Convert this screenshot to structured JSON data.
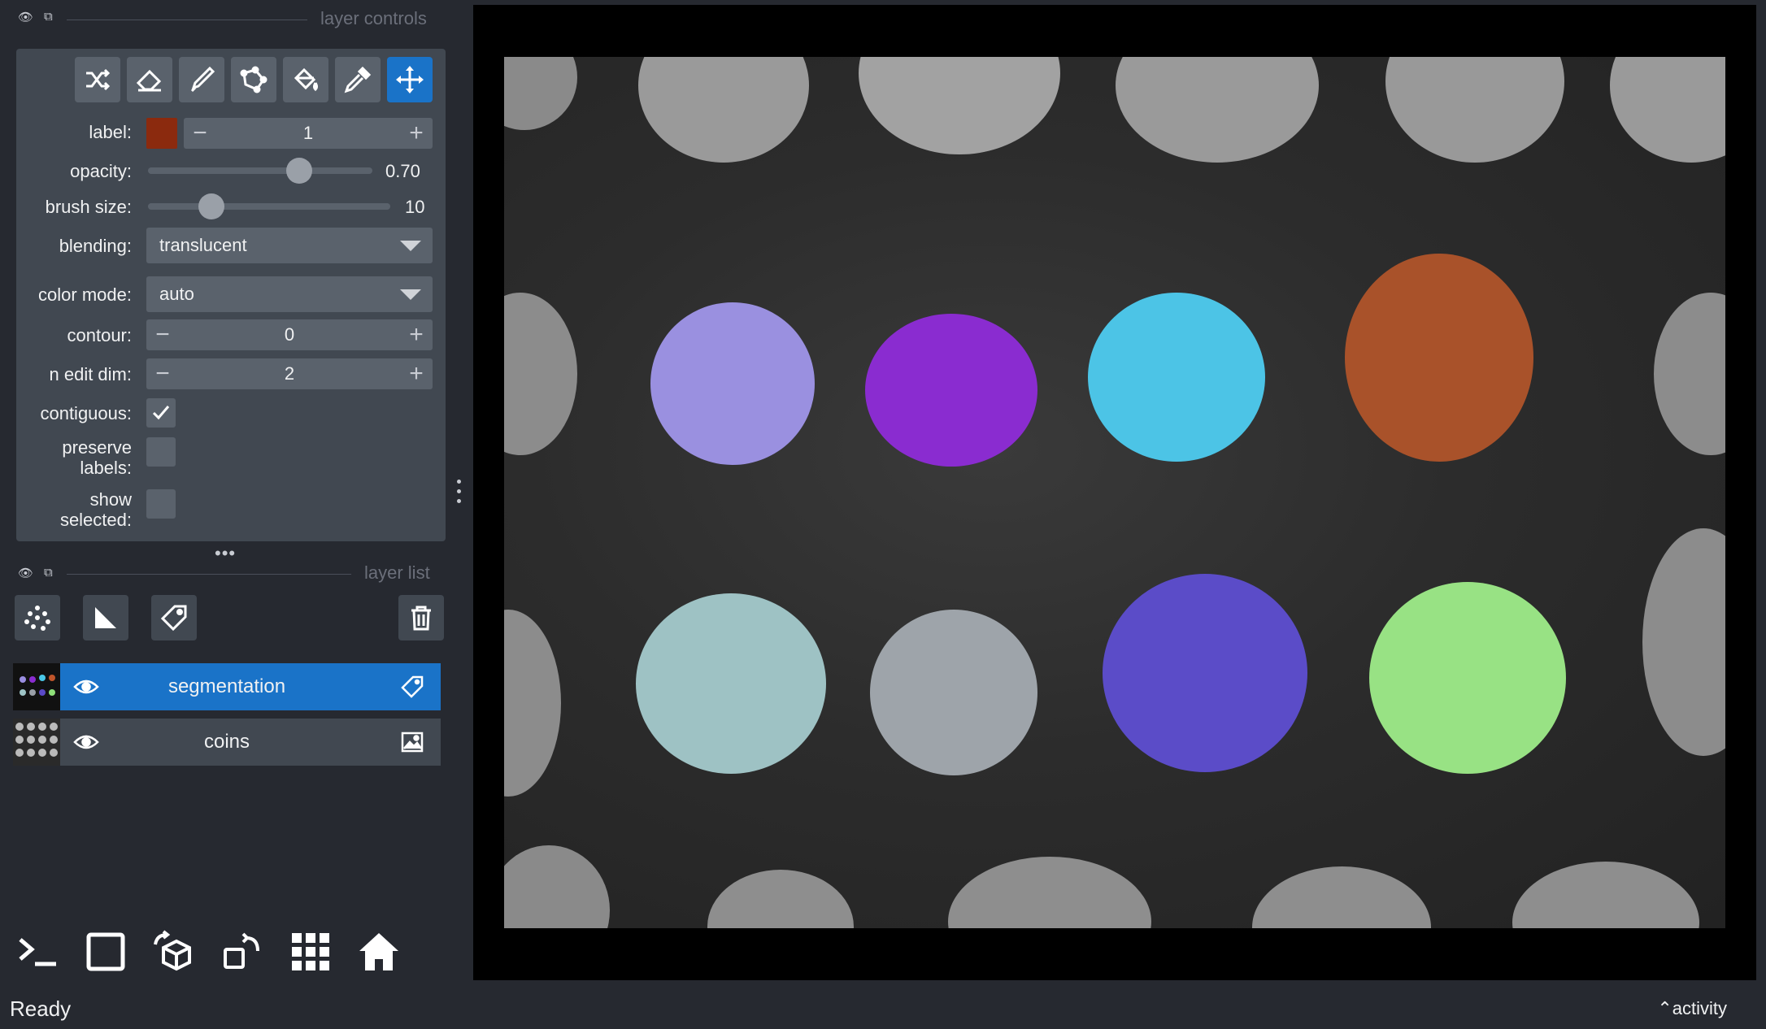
{
  "layer_controls": {
    "title": "layer controls",
    "tools": [
      {
        "icon": "shuffle-icon",
        "active": false
      },
      {
        "icon": "eraser-icon",
        "active": false
      },
      {
        "icon": "paintbrush-icon",
        "active": false
      },
      {
        "icon": "polygon-icon",
        "active": false
      },
      {
        "icon": "fill-bucket-icon",
        "active": false
      },
      {
        "icon": "color-picker-icon",
        "active": false
      },
      {
        "icon": "pan-zoom-icon",
        "active": true
      }
    ],
    "label": {
      "name": "label:",
      "value": "1",
      "color": "#8b2a0e"
    },
    "opacity": {
      "name": "opacity:",
      "value": "0.70",
      "fraction": 0.7
    },
    "brush_size": {
      "name": "brush size:",
      "value": "10",
      "fraction": 0.26
    },
    "blending": {
      "name": "blending:",
      "value": "translucent"
    },
    "color_mode": {
      "name": "color mode:",
      "value": "auto"
    },
    "contour": {
      "name": "contour:",
      "value": "0"
    },
    "n_edit_dim": {
      "name": "n edit dim:",
      "value": "2"
    },
    "contiguous": {
      "name": "contiguous:",
      "checked": true
    },
    "preserve_labels": {
      "line1": "preserve",
      "line2": "labels:",
      "checked": false
    },
    "show_selected": {
      "line1": "show",
      "line2": "selected:",
      "checked": false
    }
  },
  "layer_list": {
    "title": "layer list",
    "buttons": [
      "points-icon",
      "shapes-icon",
      "labels-icon",
      "delete-icon"
    ],
    "layers": [
      {
        "name": "segmentation",
        "type": "labels",
        "selected": true,
        "visible": true
      },
      {
        "name": "coins",
        "type": "image",
        "selected": false,
        "visible": true
      }
    ]
  },
  "bottom_buttons": [
    "console-icon",
    "ndisplay-icon",
    "roll-dims-icon",
    "transpose-icon",
    "grid-icon",
    "home-icon"
  ],
  "status": {
    "text": "Ready",
    "activity": "activity"
  },
  "colors": {
    "accent": "#1a73c8",
    "background": "#262930",
    "panel": "#414851",
    "control": "#5a626c"
  }
}
